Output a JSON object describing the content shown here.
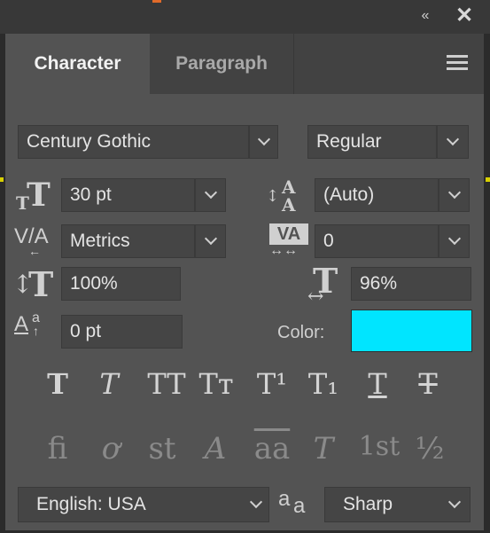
{
  "tabs": {
    "character": "Character",
    "paragraph": "Paragraph"
  },
  "font": {
    "family": "Century Gothic",
    "style": "Regular"
  },
  "size": {
    "value": "30 pt"
  },
  "leading": {
    "value": "(Auto)"
  },
  "kerning": {
    "value": "Metrics"
  },
  "tracking": {
    "value": "0"
  },
  "vertical_scale": {
    "value": "100%"
  },
  "horizontal_scale": {
    "value": "96%"
  },
  "baseline_shift": {
    "value": "0 pt"
  },
  "color": {
    "label": "Color:",
    "swatch": "#00e5ff"
  },
  "glyph_buttons": [
    "T",
    "T",
    "TT",
    "Tт",
    "T¹",
    "T₁",
    "T",
    "T"
  ],
  "opentype_buttons": [
    "fi",
    "ơ",
    "st",
    "A",
    "aa",
    "T",
    "1st",
    "½"
  ],
  "language": {
    "value": "English: USA"
  },
  "aa_icon": "aa",
  "antialias": {
    "value": "Sharp"
  },
  "window_icons": [
    "collapse-icon",
    "close-icon"
  ]
}
